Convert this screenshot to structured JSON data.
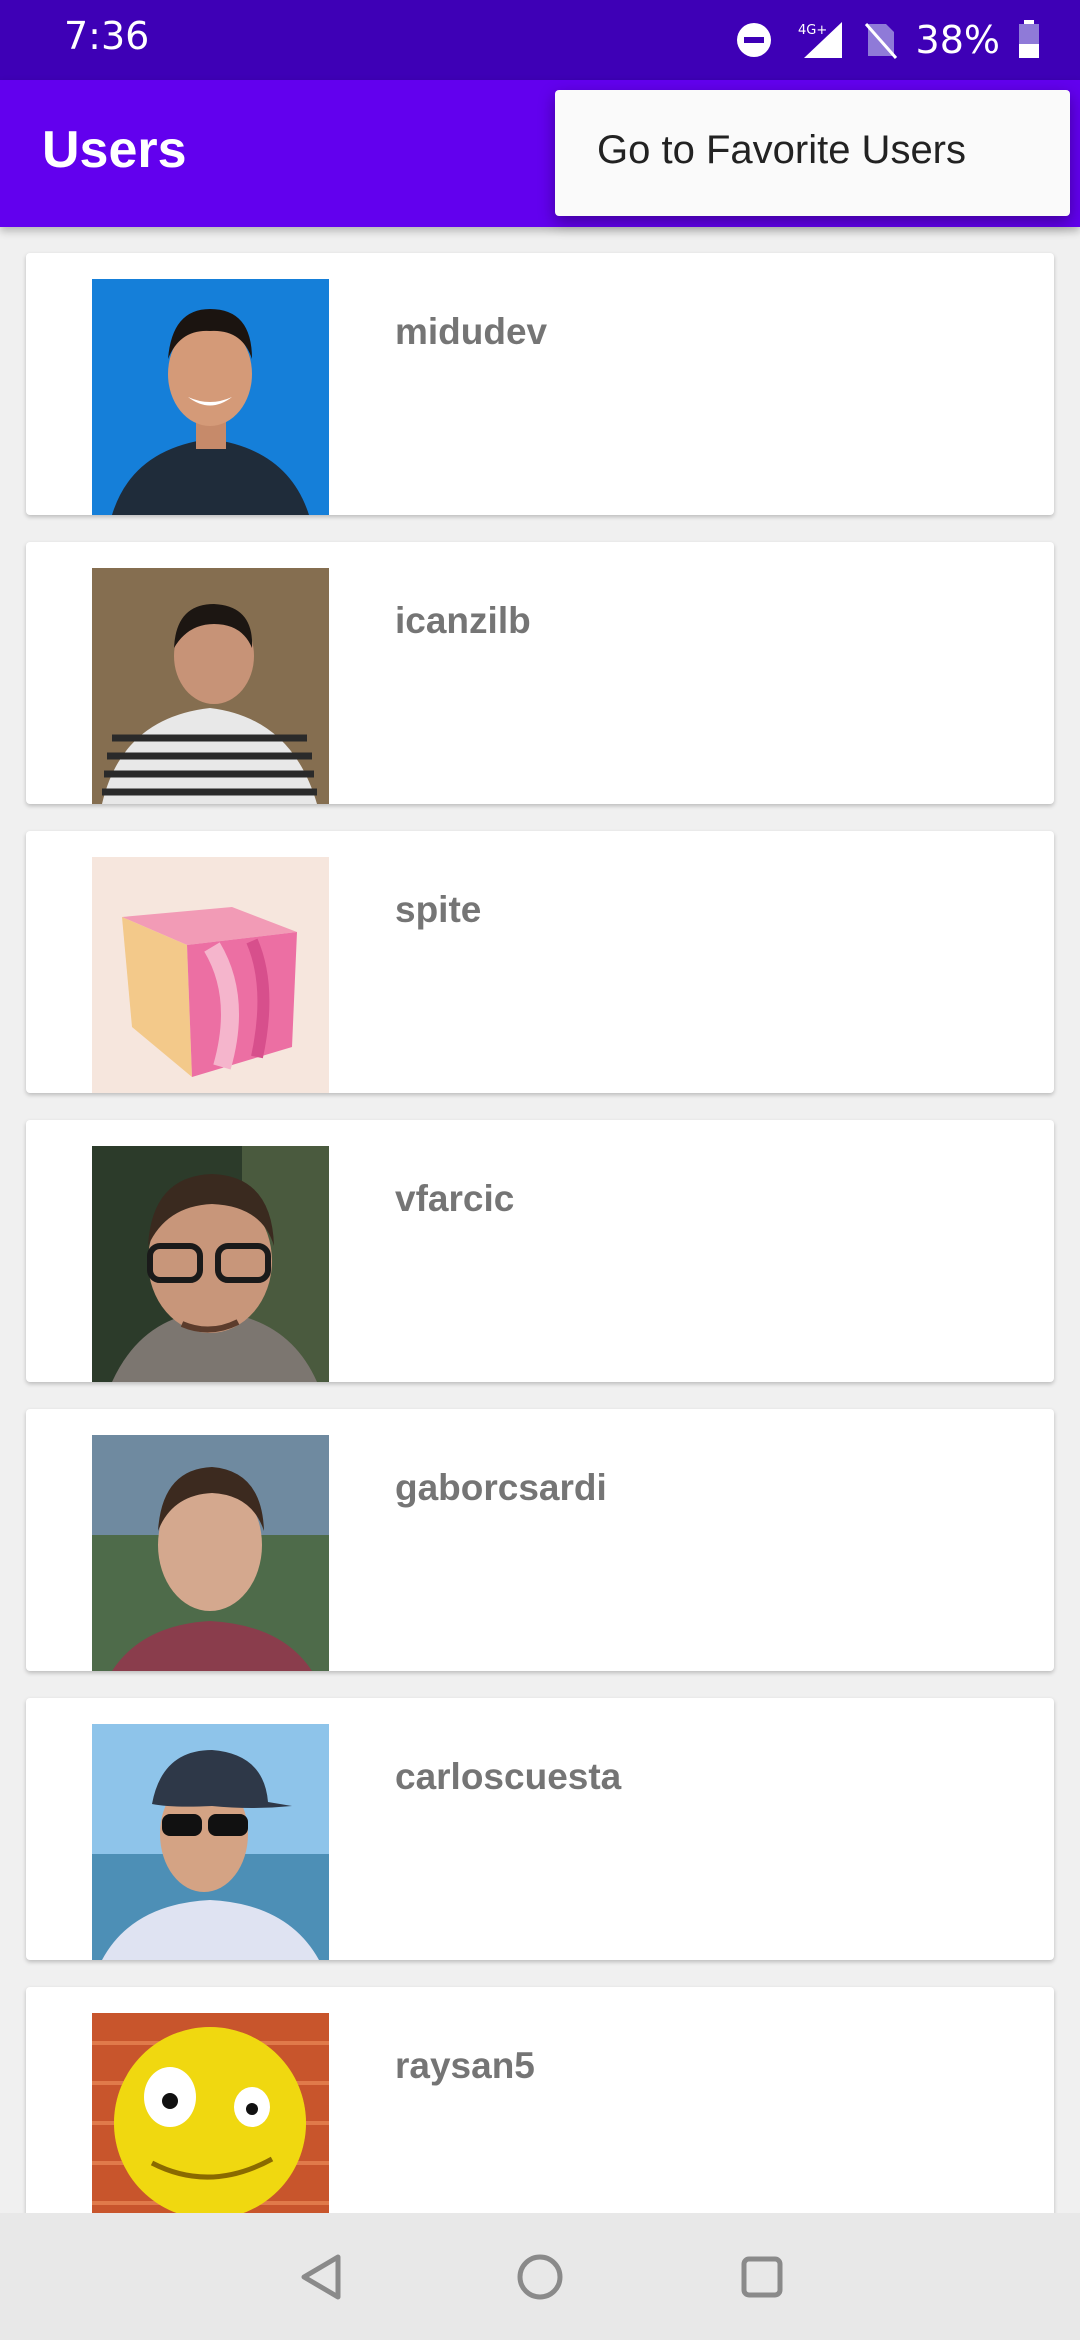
{
  "status_bar": {
    "time": "7:36",
    "network": "4G+",
    "battery_percent": "38%",
    "icons": [
      "do-not-disturb-icon",
      "signal-icon",
      "no-sim-icon",
      "battery-icon"
    ]
  },
  "app_bar": {
    "title": "Users",
    "background_color": "#6200ee"
  },
  "popup_menu": {
    "items": [
      {
        "label": "Go to Favorite Users"
      }
    ]
  },
  "users": [
    {
      "login": "midudev",
      "avatar": "avatar-photo-blue"
    },
    {
      "login": "icanzilb",
      "avatar": "avatar-photo-brown"
    },
    {
      "login": "spite",
      "avatar": "avatar-pink-cube"
    },
    {
      "login": "vfarcic",
      "avatar": "avatar-photo-glasses"
    },
    {
      "login": "gaborcsardi",
      "avatar": "avatar-photo-outdoor"
    },
    {
      "login": "carloscuesta",
      "avatar": "avatar-photo-cap"
    },
    {
      "login": "raysan5",
      "avatar": "avatar-yellow-smiley"
    }
  ],
  "nav_bar": {
    "buttons": [
      "back-icon",
      "home-icon",
      "recents-icon"
    ]
  }
}
